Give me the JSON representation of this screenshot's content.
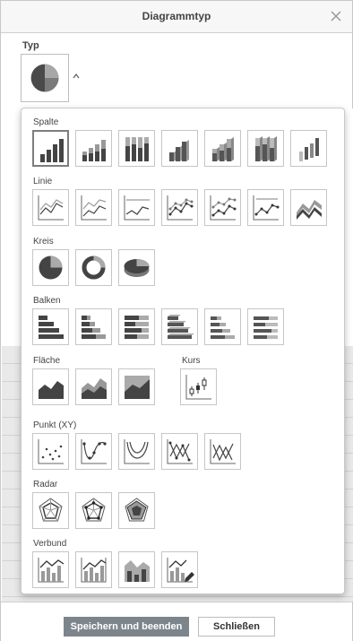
{
  "dialog": {
    "title": "Diagrammtyp",
    "type_label": "Typ",
    "save_label": "Speichern und beenden",
    "close_label": "Schließen"
  },
  "groups": [
    {
      "label": "Spalte",
      "tiles": [
        "col-clustered",
        "col-stacked",
        "col-stacked-100",
        "col-3d-clustered",
        "col-3d-stacked",
        "col-3d-stacked-100",
        "col-3d"
      ]
    },
    {
      "label": "Linie",
      "tiles": [
        "line",
        "line-stacked",
        "line-stacked-100",
        "line-markers",
        "line-stacked-markers",
        "line-stacked-100-markers",
        "line-3d"
      ]
    },
    {
      "label": "Kreis",
      "tiles": [
        "pie",
        "doughnut",
        "pie-3d"
      ]
    },
    {
      "label": "Balken",
      "tiles": [
        "bar-clustered",
        "bar-stacked",
        "bar-stacked-100",
        "bar-3d-clustered",
        "bar-3d-stacked",
        "bar-3d-stacked-100"
      ]
    },
    {
      "label": "Fläche",
      "tiles": [
        "area",
        "area-stacked",
        "area-stacked-100"
      ]
    },
    {
      "label": "Kurs",
      "tiles": [
        "stock"
      ]
    },
    {
      "label": "Punkt (XY)",
      "tiles": [
        "scatter",
        "scatter-smooth-markers",
        "scatter-smooth",
        "scatter-lines-markers",
        "scatter-lines"
      ]
    },
    {
      "label": "Radar",
      "tiles": [
        "radar",
        "radar-markers",
        "radar-filled"
      ]
    },
    {
      "label": "Verbund",
      "tiles": [
        "combo-col-line",
        "combo-col-line-secondary",
        "combo-area-col",
        "combo-custom"
      ]
    }
  ],
  "selected_tile": "col-clustered",
  "colors": {
    "accent": "#7d858c",
    "dark": "#444444",
    "mid": "#8c8c8c",
    "light": "#c4c4c4"
  }
}
